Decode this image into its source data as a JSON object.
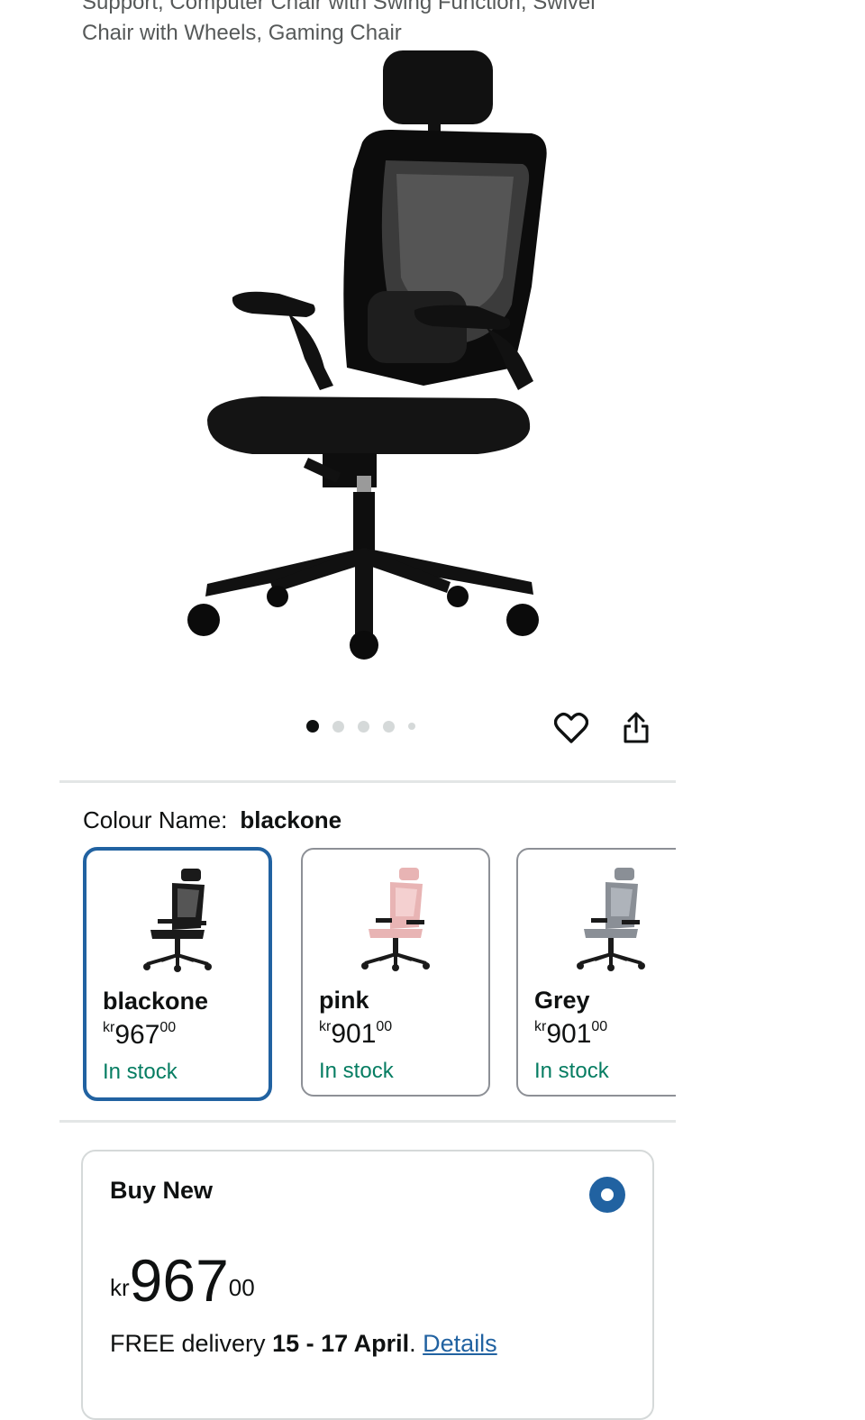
{
  "product": {
    "title_line1": "Support, Computer Chair with Swing Function, Swivel",
    "title_line2": "Chair with Wheels, Gaming Chair",
    "image_alt": "office-chair-black"
  },
  "gallery": {
    "dot_count": 5,
    "active_index": 0
  },
  "icons": {
    "wishlist": "heart-icon",
    "share": "share-icon"
  },
  "colour": {
    "label": "Colour Name:",
    "selected": "blackone"
  },
  "swatches": [
    {
      "name": "blackone",
      "currency": "kr",
      "whole": "967",
      "fraction": "00",
      "stock": "In stock",
      "color": "#1a1a1a",
      "selected": true
    },
    {
      "name": "pink",
      "currency": "kr",
      "whole": "901",
      "fraction": "00",
      "stock": "In stock",
      "color": "#e8b4b4",
      "selected": false
    },
    {
      "name": "Grey",
      "currency": "kr",
      "whole": "901",
      "fraction": "00",
      "stock": "In stock",
      "color": "#8a8f96",
      "selected": false
    }
  ],
  "buy_new": {
    "title": "Buy New",
    "currency": "kr",
    "whole": "967",
    "fraction": "00",
    "delivery_prefix": "FREE delivery",
    "delivery_dates": "15 - 17 April",
    "delivery_suffix": ".",
    "details_link": "Details"
  },
  "colors": {
    "accent": "#2162a1",
    "in_stock": "#067d62"
  }
}
